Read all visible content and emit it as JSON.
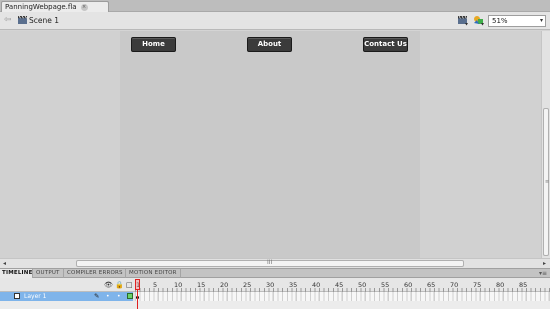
{
  "document": {
    "tab_title": "PanningWebpage.fla",
    "close_glyph": "×"
  },
  "edit_bar": {
    "back_glyph": "⇦",
    "scene_label": "Scene 1",
    "zoom_value": "51%",
    "zoom_arrow": "▾",
    "icons": [
      "edit-scene-icon",
      "edit-symbols-icon"
    ]
  },
  "stage": {
    "nav_buttons": [
      "Home",
      "About",
      "Contact Us"
    ],
    "button_color": "#3b3b3b",
    "stage_color": "#c9c9c9"
  },
  "scrollbars": {
    "vertical_grip": "≡",
    "horizontal_grip": "III",
    "left_glyph": "◂",
    "right_glyph": "▸"
  },
  "panel_tabs": {
    "tabs": [
      "TIMELINE",
      "OUTPUT",
      "COMPILER ERRORS",
      "MOTION EDITOR"
    ],
    "active": "TIMELINE",
    "menu_glyph": "▾≡"
  },
  "timeline": {
    "header_icons": {
      "eye": "👁",
      "lock": "🔒",
      "outline": "□"
    },
    "frame_numbers": [
      "1",
      "5",
      "10",
      "15",
      "20",
      "25",
      "30",
      "35",
      "40",
      "45",
      "50",
      "55",
      "60",
      "65",
      "70",
      "75",
      "80",
      "85"
    ],
    "layers": [
      {
        "name": "Layer 1",
        "pencil": "✎",
        "dot": "•",
        "color": "#6ad36a"
      }
    ],
    "current_frame": 1
  }
}
